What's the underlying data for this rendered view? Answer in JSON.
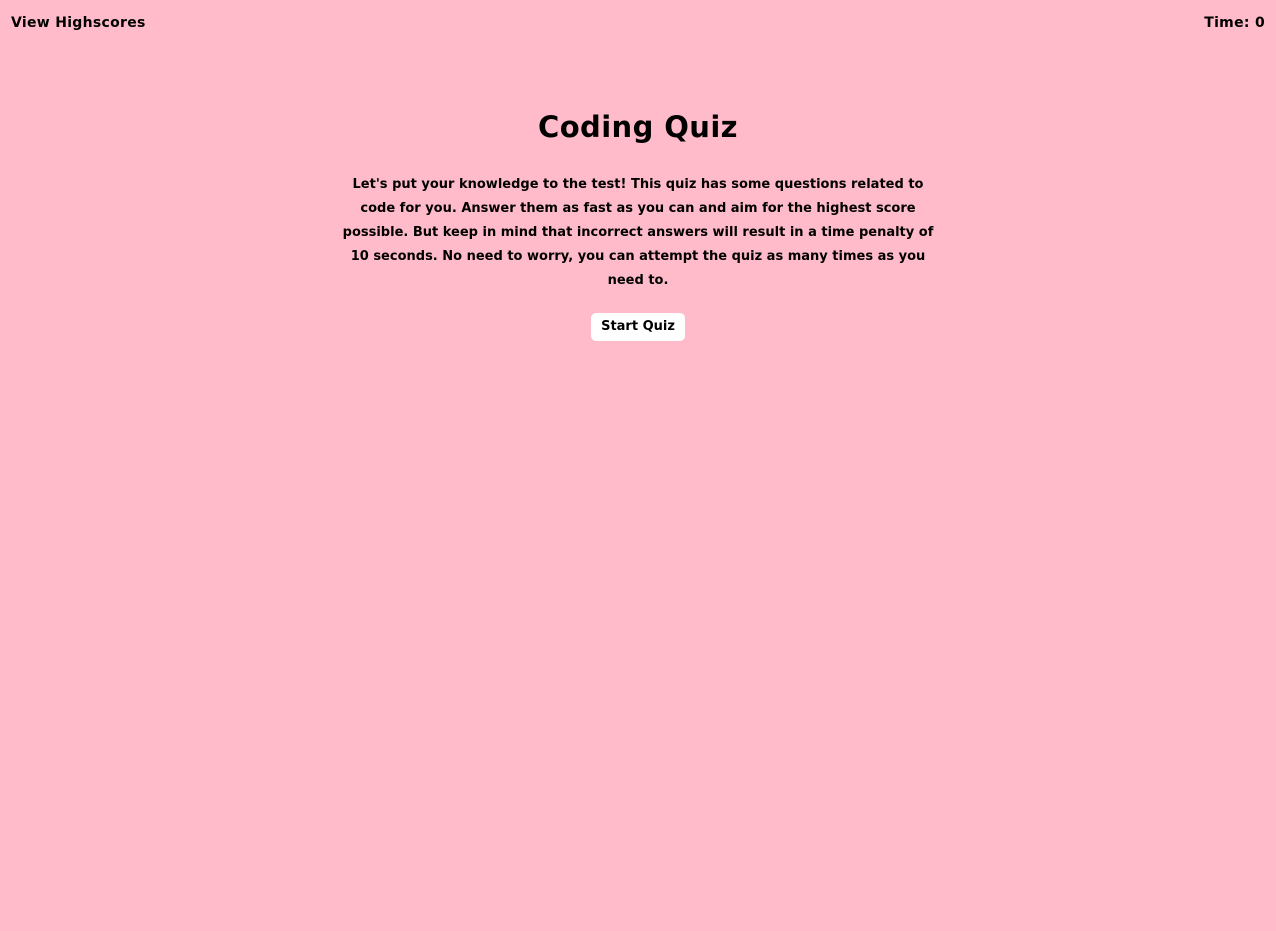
{
  "header": {
    "highscores_label": "View Highscores",
    "timer_label": "Time: ",
    "timer_value": "0"
  },
  "main": {
    "title": "Coding Quiz",
    "description": "Let's put your knowledge to the test! This quiz has some questions related to code for you. Answer them as fast as you can and aim for the highest score possible. But keep in mind that incorrect answers will result in a time penalty of 10 seconds. No need to worry, you can attempt the quiz as many times as you need to.",
    "start_label": "Start Quiz"
  },
  "colors": {
    "background": "#ffbbc9",
    "button_background": "#ffffff",
    "text": "#000000"
  }
}
